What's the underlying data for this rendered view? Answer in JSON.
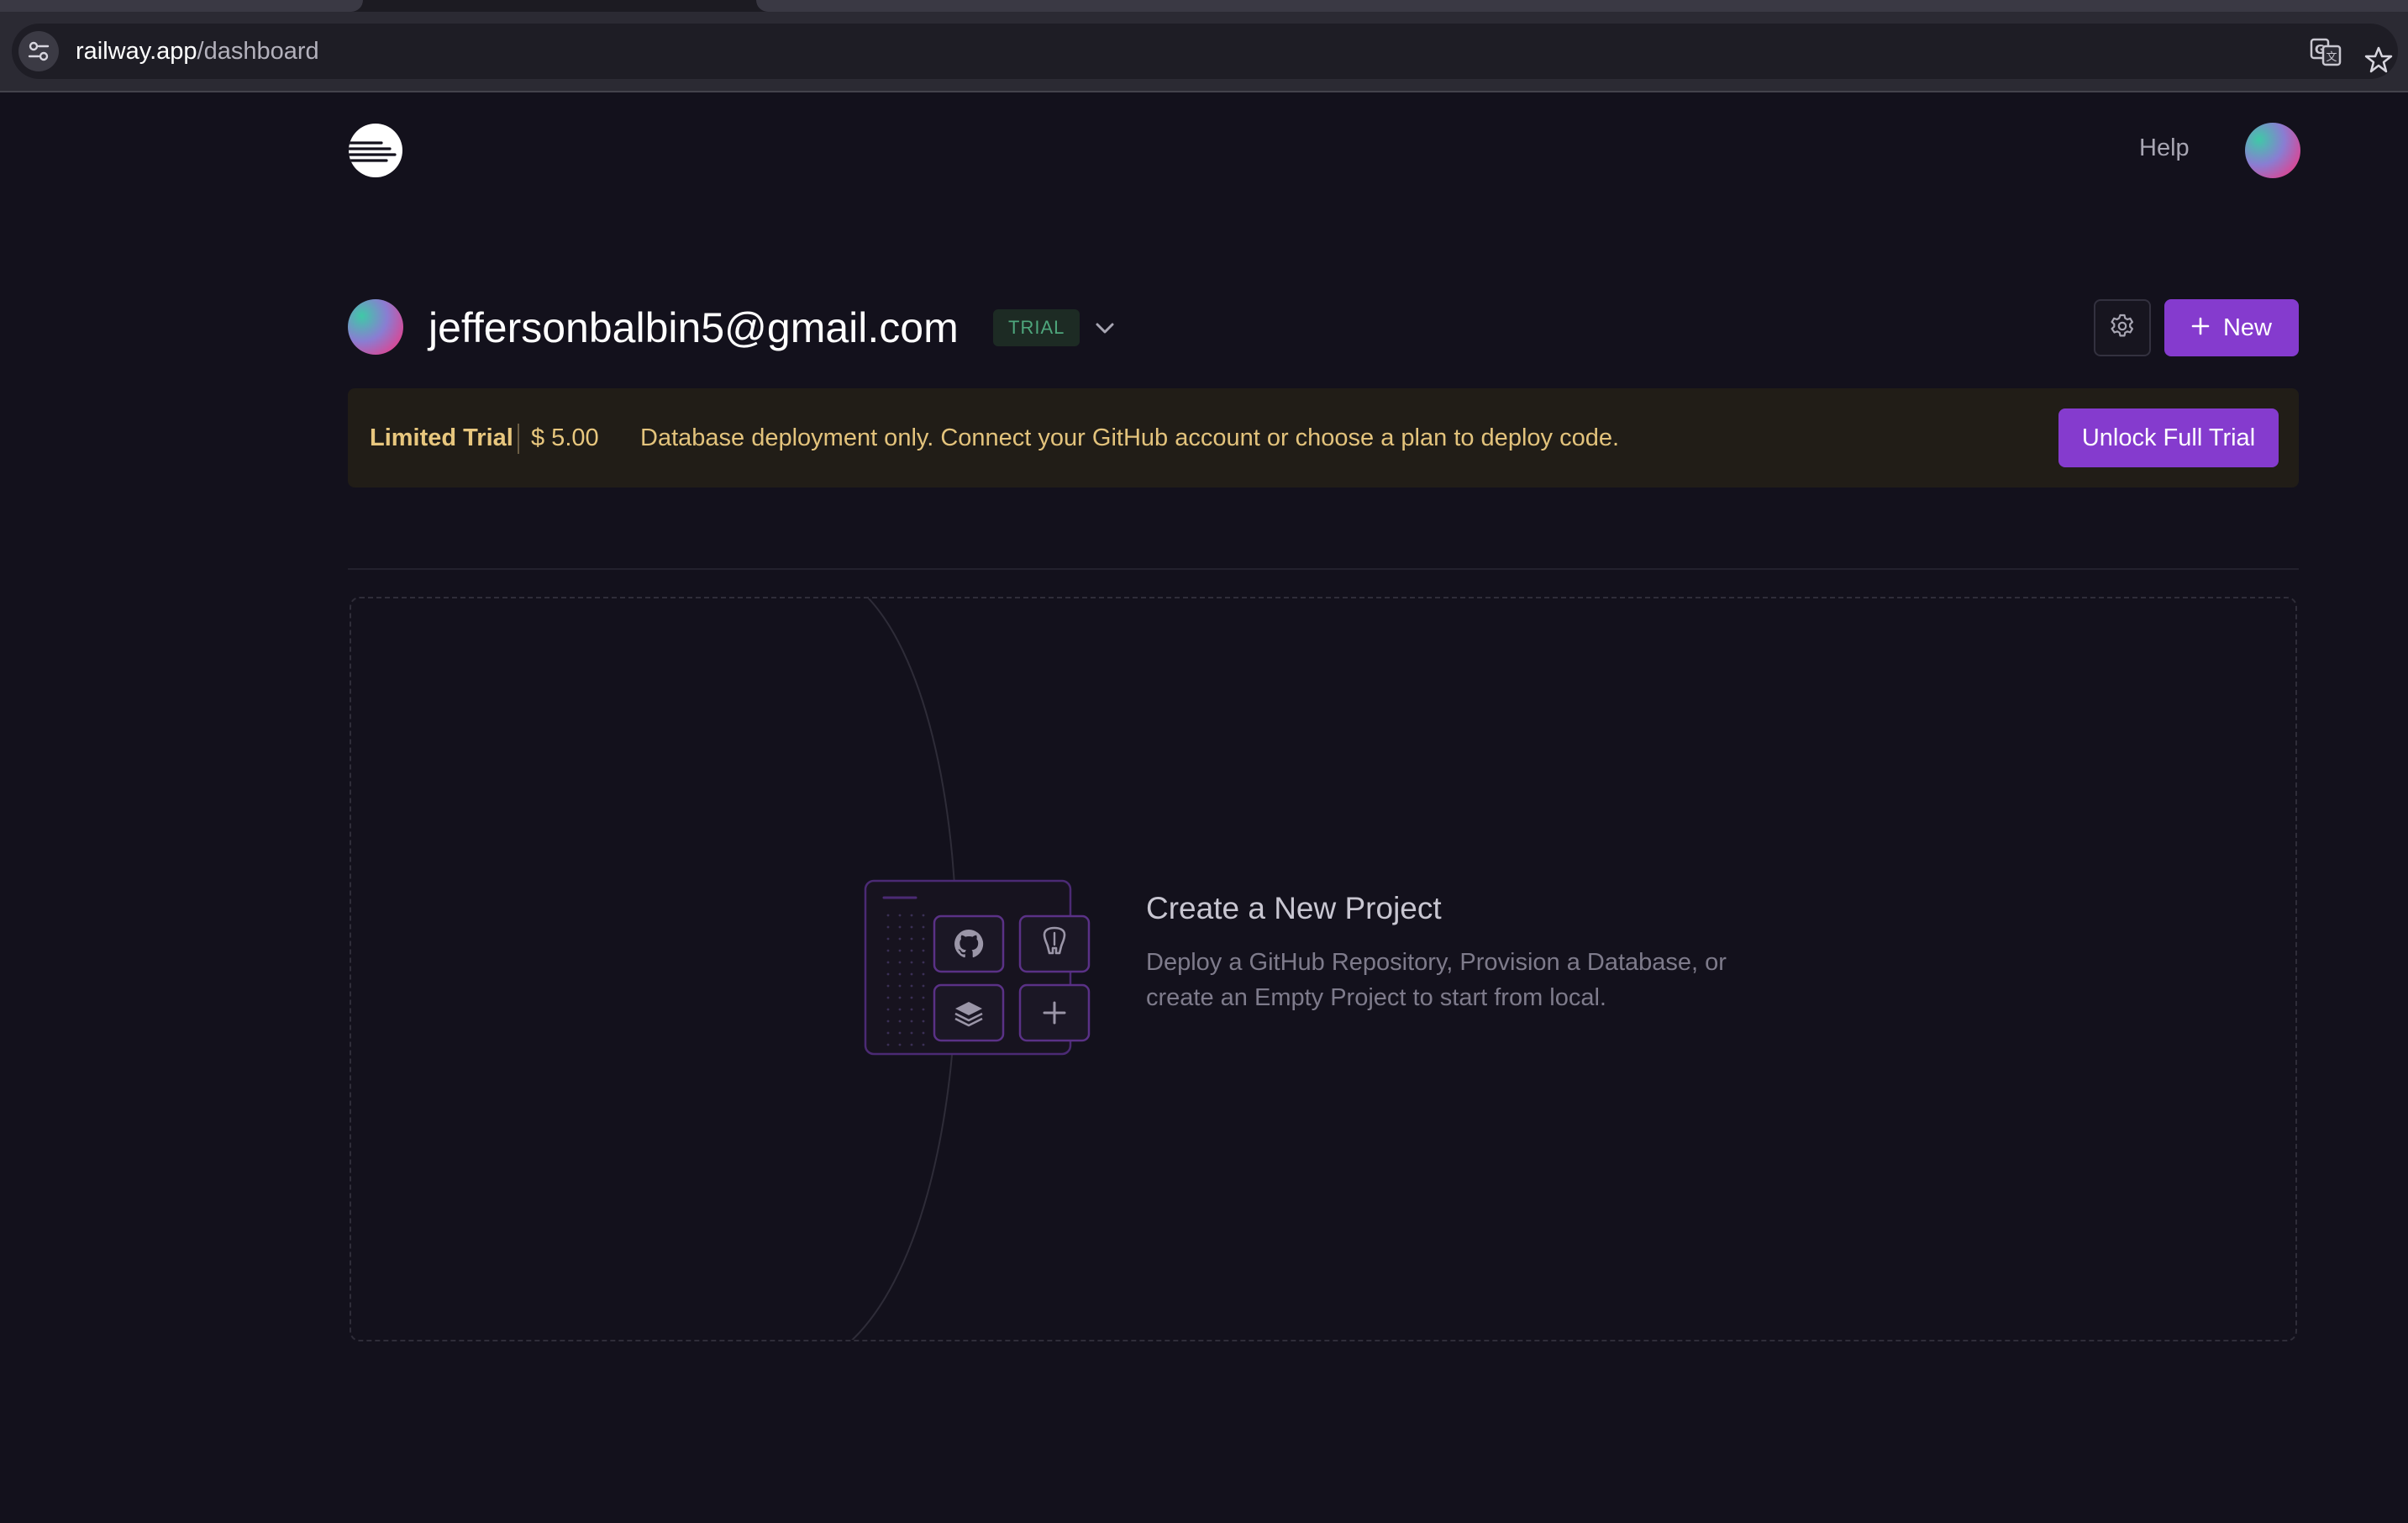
{
  "browser": {
    "url_host": "railway.app",
    "url_path": "/dashboard"
  },
  "header": {
    "help_label": "Help"
  },
  "account": {
    "email": "jeffersonbalbin5@gmail.com",
    "plan_badge": "TRIAL",
    "new_button_label": "New"
  },
  "banner": {
    "title": "Limited Trial",
    "credit": "$ 5.00",
    "message": "Database deployment only. Connect your GitHub account or choose a plan to deploy code.",
    "button_label": "Unlock Full Trial"
  },
  "empty_state": {
    "title": "Create a New Project",
    "description": "Deploy a GitHub Repository, Provision a Database, or create an Empty Project to start from local.",
    "tiles": [
      "github-icon",
      "postgres-icon",
      "stack-icon",
      "plus-icon"
    ]
  },
  "colors": {
    "background": "#13111c",
    "accent": "#853bce",
    "banner_bg": "#211d17",
    "banner_text": "#e8c77e",
    "trial_badge": "#4ea67c"
  }
}
